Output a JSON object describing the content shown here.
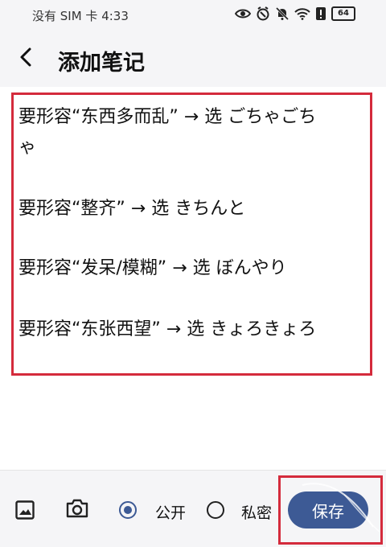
{
  "status_bar": {
    "carrier_time": "没有 SIM 卡 4:33",
    "battery_level": "64",
    "icons": [
      "eye-icon",
      "alarm-icon",
      "mute-icon",
      "wifi-icon",
      "alert-icon",
      "battery-icon"
    ]
  },
  "header": {
    "back_icon": "chevron-left-icon",
    "title": "添加笔记"
  },
  "note": {
    "lines": [
      " 要形容“东西多而乱” → 选 ごちゃごち",
      "ゃ",
      "要形容“整齐” → 选 きちんと",
      "要形容“发呆/模糊” → 选 ぼんやり",
      "要形容“东张西望” → 选 きょろきょろ"
    ],
    "highlight_color": "#d42b3c"
  },
  "toolbar": {
    "image_icon": "image-icon",
    "camera_icon": "camera-icon",
    "visibility_options": [
      {
        "label": "公开",
        "selected": true
      },
      {
        "label": "私密",
        "selected": false
      }
    ],
    "save_label": "保存",
    "accent_color": "#3d5a95"
  }
}
